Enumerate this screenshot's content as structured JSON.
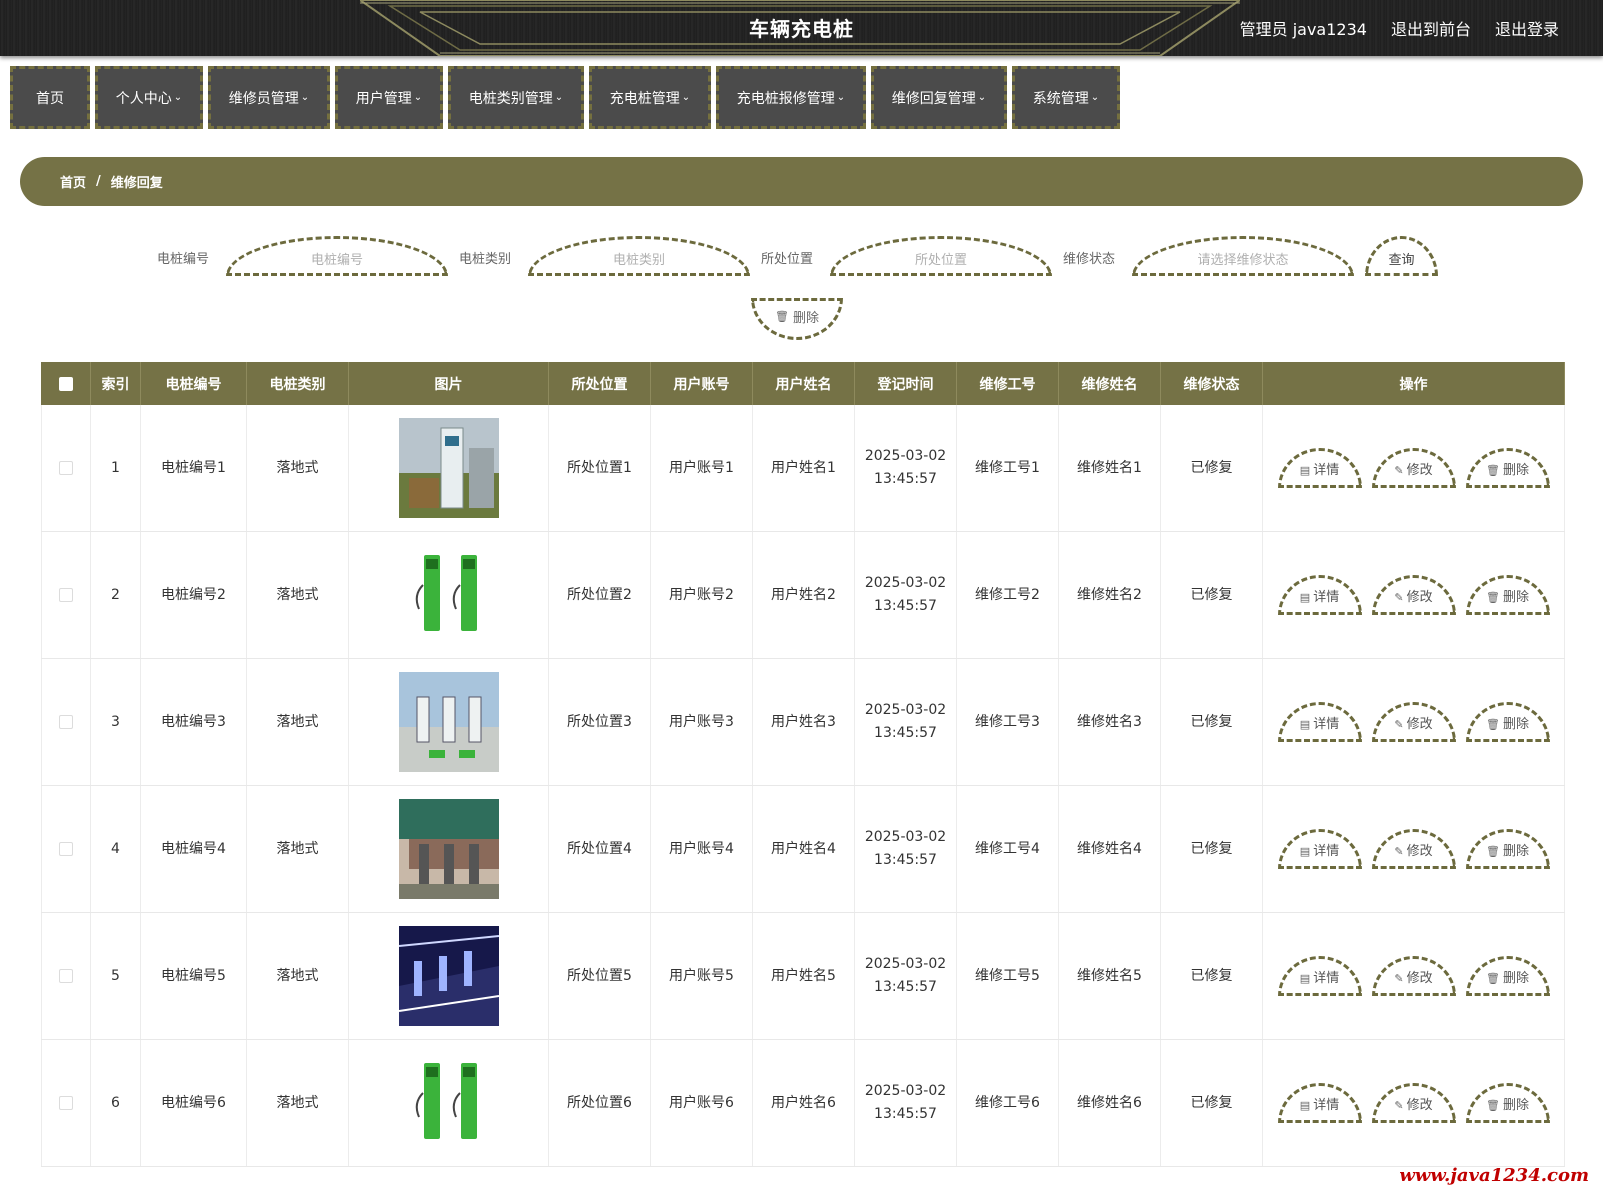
{
  "header": {
    "title": "车辆充电桩",
    "admin_label": "管理员 java1234",
    "front_link": "退出到前台",
    "logout_link": "退出登录"
  },
  "nav": {
    "items": [
      {
        "label": "首页",
        "dropdown": false
      },
      {
        "label": "个人中心",
        "dropdown": true
      },
      {
        "label": "维修员管理",
        "dropdown": true
      },
      {
        "label": "用户管理",
        "dropdown": true
      },
      {
        "label": "电桩类别管理",
        "dropdown": true
      },
      {
        "label": "充电桩管理",
        "dropdown": true
      },
      {
        "label": "充电桩报修管理",
        "dropdown": true
      },
      {
        "label": "维修回复管理",
        "dropdown": true
      },
      {
        "label": "系统管理",
        "dropdown": true
      }
    ]
  },
  "breadcrumb": {
    "home": "首页",
    "separator": "/",
    "current": "维修回复"
  },
  "search": {
    "pile_no": {
      "label": "电桩编号",
      "placeholder": "电桩编号"
    },
    "pile_type": {
      "label": "电桩类别",
      "placeholder": "电桩类别"
    },
    "location": {
      "label": "所处位置",
      "placeholder": "所处位置"
    },
    "status": {
      "label": "维修状态",
      "placeholder": "请选择维修状态"
    },
    "query_button": "查询",
    "delete_button": "删除"
  },
  "table": {
    "headers": [
      "索引",
      "电桩编号",
      "电桩类别",
      "图片",
      "所处位置",
      "用户账号",
      "用户姓名",
      "登记时间",
      "维修工号",
      "维修姓名",
      "维修状态",
      "操作"
    ],
    "actions": {
      "detail": "详情",
      "edit": "修改",
      "delete": "删除"
    },
    "rows": [
      {
        "index": "1",
        "pile_no": "电桩编号1",
        "type": "落地式",
        "location": "所处位置1",
        "account": "用户账号1",
        "user_name": "用户姓名1",
        "date": "2025-03-02",
        "time": "13:45:57",
        "worker_no": "维修工号1",
        "worker_name": "维修姓名1",
        "status": "已修复"
      },
      {
        "index": "2",
        "pile_no": "电桩编号2",
        "type": "落地式",
        "location": "所处位置2",
        "account": "用户账号2",
        "user_name": "用户姓名2",
        "date": "2025-03-02",
        "time": "13:45:57",
        "worker_no": "维修工号2",
        "worker_name": "维修姓名2",
        "status": "已修复"
      },
      {
        "index": "3",
        "pile_no": "电桩编号3",
        "type": "落地式",
        "location": "所处位置3",
        "account": "用户账号3",
        "user_name": "用户姓名3",
        "date": "2025-03-02",
        "time": "13:45:57",
        "worker_no": "维修工号3",
        "worker_name": "维修姓名3",
        "status": "已修复"
      },
      {
        "index": "4",
        "pile_no": "电桩编号4",
        "type": "落地式",
        "location": "所处位置4",
        "account": "用户账号4",
        "user_name": "用户姓名4",
        "date": "2025-03-02",
        "time": "13:45:57",
        "worker_no": "维修工号4",
        "worker_name": "维修姓名4",
        "status": "已修复"
      },
      {
        "index": "5",
        "pile_no": "电桩编号5",
        "type": "落地式",
        "location": "所处位置5",
        "account": "用户账号5",
        "user_name": "用户姓名5",
        "date": "2025-03-02",
        "time": "13:45:57",
        "worker_no": "维修工号5",
        "worker_name": "维修姓名5",
        "status": "已修复"
      },
      {
        "index": "6",
        "pile_no": "电桩编号6",
        "type": "落地式",
        "location": "所处位置6",
        "account": "用户账号6",
        "user_name": "用户姓名6",
        "date": "2025-03-02",
        "time": "13:45:57",
        "worker_no": "维修工号6",
        "worker_name": "维修姓名6",
        "status": "已修复"
      }
    ]
  },
  "watermark": "www.java1234.com",
  "colors": {
    "accent": "#757246",
    "nav_bg": "#4b4b4b",
    "header_bg": "#222222",
    "watermark": "#c00000"
  }
}
